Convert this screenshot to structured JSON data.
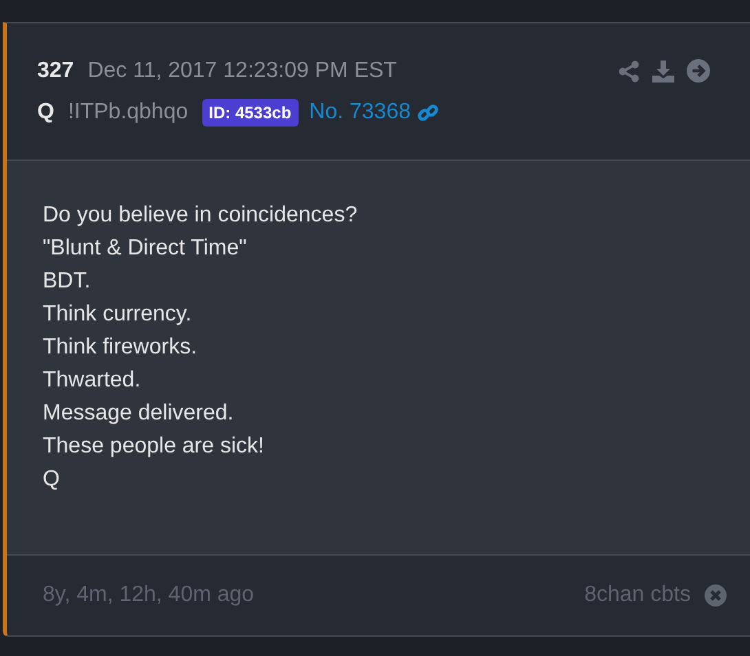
{
  "post": {
    "number": "327",
    "timestamp": "Dec 11, 2017 12:23:09 PM EST",
    "name": "Q",
    "tripcode": "!ITPb.qbhqo",
    "id_badge": "ID: 4533cb",
    "post_link": "No. 73368",
    "lines": [
      "Do you believe in coincidences?",
      "\"Blunt & Direct Time\"",
      "BDT.",
      "Think currency.",
      "Think fireworks.",
      "Thwarted.",
      "Message delivered.",
      "These people are sick!",
      "Q"
    ],
    "age": "8y, 4m, 12h, 40m ago",
    "source": "8chan cbts"
  }
}
